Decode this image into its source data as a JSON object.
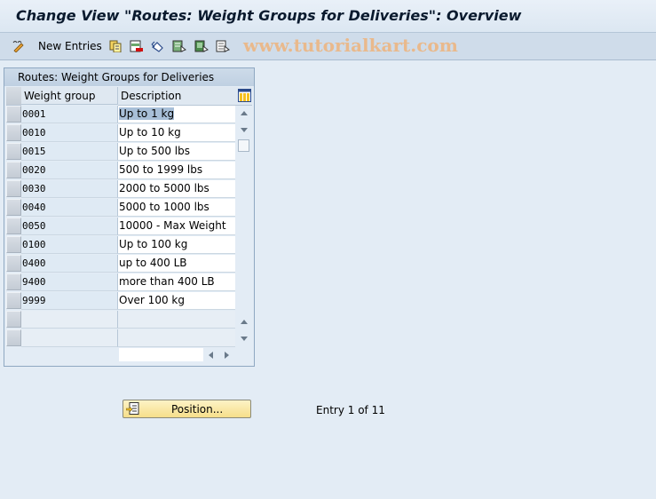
{
  "window": {
    "title": "Change View \"Routes: Weight Groups for Deliveries\": Overview"
  },
  "toolbar": {
    "new_entries_label": "New Entries",
    "icons": [
      "display-change-icon",
      "copy-icon",
      "delete-icon",
      "undo-change-icon",
      "select-all-icon",
      "select-block-icon",
      "deselect-all-icon"
    ]
  },
  "watermark": "www.tutorialkart.com",
  "table": {
    "title": "Routes: Weight Groups for Deliveries",
    "columns": [
      "Weight group",
      "Description"
    ],
    "rows": [
      {
        "weight_group": "0001",
        "description": "Up to 1 kg"
      },
      {
        "weight_group": "0010",
        "description": "Up to 10 kg"
      },
      {
        "weight_group": "0015",
        "description": "Up to 500 lbs"
      },
      {
        "weight_group": "0020",
        "description": "500 to 1999 lbs"
      },
      {
        "weight_group": "0030",
        "description": "2000 to 5000 lbs"
      },
      {
        "weight_group": "0040",
        "description": "5000 to 1000 lbs"
      },
      {
        "weight_group": "0050",
        "description": "10000 - Max Weight"
      },
      {
        "weight_group": "0100",
        "description": "Up to 100 kg"
      },
      {
        "weight_group": "0400",
        "description": "up to 400 LB"
      },
      {
        "weight_group": "9400",
        "description": "more than 400 LB"
      },
      {
        "weight_group": "9999",
        "description": "Over 100 kg"
      }
    ],
    "empty_rows": 2,
    "selected_cell": "0.description"
  },
  "footer": {
    "position_button_label": "Position...",
    "entry_text": "Entry 1 of 11"
  }
}
